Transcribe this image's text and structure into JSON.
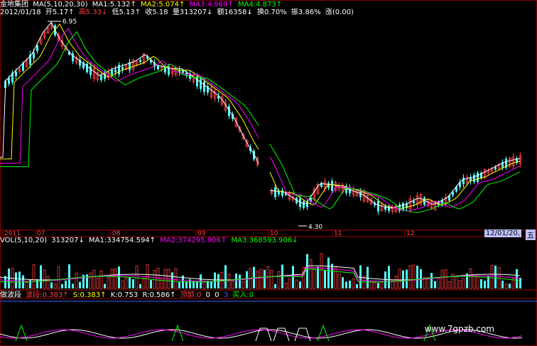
{
  "header": {
    "stock_name": "金地集团",
    "ma_label": "MA(5,10,20,30)",
    "ma1": "MA1:5.132↑",
    "ma2": "MA2:5.074↑",
    "ma3": "MA3:4.969↑",
    "ma4": "MA4:4.873↑"
  },
  "quote": {
    "date": "2012/01/18",
    "open": "开5.17↑",
    "high": "高5.33↓",
    "low": "低5.13↑",
    "close": "收5.18",
    "volume": "量313207↓",
    "amount": "额16358↓",
    "turnover": "换0.70%",
    "amplitude": "振3.86%",
    "change": "涨(0.00)"
  },
  "price_labels": {
    "high_mark": "6.95",
    "low_mark": "4.30"
  },
  "axis": {
    "months": [
      "2011",
      "07",
      "08",
      "09",
      "10",
      "11",
      "12"
    ],
    "cursor_date": "12/01/20,",
    "cursor_day": "五"
  },
  "volume_header": {
    "label": "VOL(5,10,20)",
    "vol": "313207↓",
    "ma1": "MA1:334754.594↑",
    "ma2": "MA2:374295.906↑",
    "ma3": "MA3:368593.906↓"
  },
  "indicator_header": {
    "name": "做波段",
    "wave": "波段:0.383↑",
    "s": "S:0.383↑",
    "k": "K:0.753",
    "r": "R:0.586↑",
    "top": "顶部:0",
    "v1": "0",
    "v2": "0",
    "v3": "3",
    "buy": "买入:0"
  },
  "watermark": "www.7gpzb.com",
  "colors": {
    "up": "#ff4040",
    "down": "#54ffff",
    "ma1": "#ffffff",
    "ma2": "#ffff00",
    "ma3": "#ff00ff",
    "ma4": "#00ff00"
  }
}
